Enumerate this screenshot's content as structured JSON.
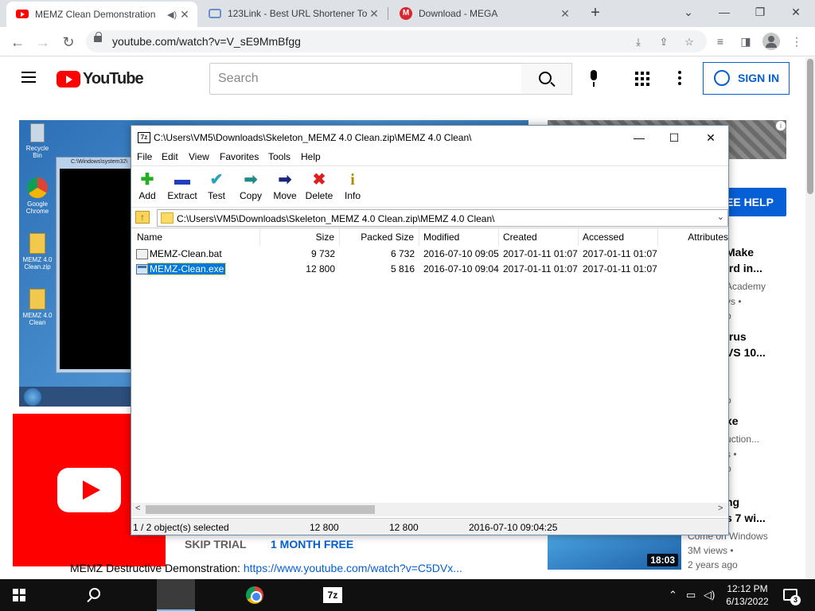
{
  "browser": {
    "tabs": [
      {
        "title": "MEMZ Clean Demonstration",
        "favicon": "youtube-icon",
        "active": true
      },
      {
        "title": "123Link - Best URL Shortener To",
        "favicon": "link-icon",
        "active": false
      },
      {
        "title": "Download - MEGA",
        "favicon": "mega-icon",
        "active": false
      }
    ],
    "url": "youtube.com/watch?v=V_sE9MmBfgg"
  },
  "youtube": {
    "logo_text": "YouTube",
    "search_placeholder": "Search",
    "signin_label": "SIGN IN",
    "help_label": "EE HELP",
    "skip_trial": "SKIP TRIAL",
    "month_free": "1 MONTH FREE",
    "description_text": "MEMZ Destructive Demonstration: ",
    "description_link": "https://www.youtube.com/watch?v=C5DVx...",
    "desktop_icons": [
      "Recycle Bin",
      "Google Chrome",
      "MEMZ 4.0 Clean.zip",
      "MEMZ 4.0 Clean"
    ],
    "cmd_title": "C:\\Windows\\system32\\",
    "recommendations": {
      "r1_l1": "Make",
      "r1_l2": "ird in...",
      "r1_ch": "Academy",
      "r1_meta": "vs •",
      "r1_age": "o",
      "r2_l1": "irus",
      "r2_l2": "VS 10...",
      "r2_meta": "o",
      "r3_l1": "xe",
      "r3_ch": "uction...",
      "r3_meta": "s •",
      "r3_age": "o",
      "r4_l1": "ng",
      "r4_l2": "s 7 wi...",
      "r4_ch": "Come on Windows",
      "r4_views": "3M views •",
      "r4_age": "2 years ago",
      "r4_duration": "18:03"
    }
  },
  "sevenzip": {
    "title": "C:\\Users\\VM5\\Downloads\\Skeleton_MEMZ 4.0 Clean.zip\\MEMZ 4.0 Clean\\",
    "menu": [
      "File",
      "Edit",
      "View",
      "Favorites",
      "Tools",
      "Help"
    ],
    "toolbar": [
      {
        "label": "Add",
        "icon": "add-icon",
        "glyph": "✚",
        "color": "#22b022"
      },
      {
        "label": "Extract",
        "icon": "extract-icon",
        "glyph": "▬",
        "color": "#1f3fbf"
      },
      {
        "label": "Test",
        "icon": "test-icon",
        "glyph": "✔",
        "color": "#25a5b5"
      },
      {
        "label": "Copy",
        "icon": "copy-icon",
        "glyph": "➡",
        "color": "#1e8a8a"
      },
      {
        "label": "Move",
        "icon": "move-icon",
        "glyph": "➡",
        "color": "#1a237e"
      },
      {
        "label": "Delete",
        "icon": "delete-icon",
        "glyph": "✖",
        "color": "#e02020"
      },
      {
        "label": "Info",
        "icon": "info-icon",
        "glyph": "i",
        "color": "#b08c00"
      }
    ],
    "path": "C:\\Users\\VM5\\Downloads\\Skeleton_MEMZ 4.0 Clean.zip\\MEMZ 4.0 Clean\\",
    "columns": [
      "Name",
      "Size",
      "Packed Size",
      "Modified",
      "Created",
      "Accessed",
      "Attributes"
    ],
    "files": [
      {
        "name": "MEMZ-Clean.bat",
        "size": "9 732",
        "packed": "6 732",
        "modified": "2016-07-10 09:05",
        "created": "2017-01-11 01:07",
        "accessed": "2017-01-11 01:07",
        "type": "bat",
        "selected": false
      },
      {
        "name": "MEMZ-Clean.exe",
        "size": "12 800",
        "packed": "5 816",
        "modified": "2016-07-10 09:04",
        "created": "2017-01-11 01:07",
        "accessed": "2017-01-11 01:07",
        "type": "exe",
        "selected": true
      }
    ],
    "status": {
      "selection": "1 / 2 object(s) selected",
      "size": "12 800",
      "packed": "12 800",
      "modified": "2016-07-10 09:04:25"
    }
  },
  "taskbar": {
    "time": "12:12 PM",
    "date": "6/13/2022",
    "notifications": "3",
    "app_7z": "7z"
  }
}
